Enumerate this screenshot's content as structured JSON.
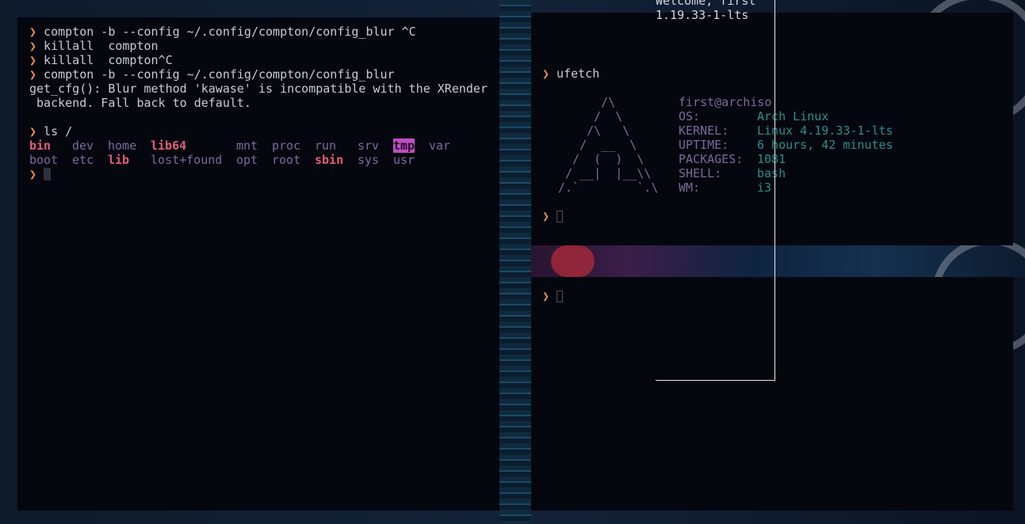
{
  "colors": {
    "prompt": "#f08a4b",
    "dir": "#7b6a9a",
    "bold_dir": "#e35e7a",
    "tmp_bg": "#c44cc4",
    "value": "#2a8f8a",
    "terminal_bg": "#05070f"
  },
  "terminal1": {
    "history": [
      {
        "prompt": "❯",
        "cmd": " compton -b --config ~/.config/compton/config_blur ^C"
      },
      {
        "prompt": "❯",
        "cmd": " killall  compton"
      },
      {
        "prompt": "❯",
        "cmd": " killall  compton^C"
      },
      {
        "prompt": "❯",
        "cmd": " compton -b --config ~/.config/compton/config_blur"
      }
    ],
    "error_line1": "get_cfg(): Blur method 'kawase' is incompatible with the XRender",
    "error_line2": " backend. Fall back to default.",
    "ls_prompt": "❯",
    "ls_cmd": " ls /",
    "ls_items": [
      {
        "name": "bin",
        "style": "b"
      },
      {
        "name": "dev",
        "style": "d"
      },
      {
        "name": "home",
        "style": "d"
      },
      {
        "name": "lib64",
        "style": "b"
      },
      {
        "name": "mnt",
        "style": "d"
      },
      {
        "name": "proc",
        "style": "d"
      },
      {
        "name": "run",
        "style": "d"
      },
      {
        "name": "srv",
        "style": "d"
      },
      {
        "name": "tmp",
        "style": "tmp"
      },
      {
        "name": "var",
        "style": "d"
      },
      {
        "name": "boot",
        "style": "d"
      },
      {
        "name": "etc",
        "style": "d"
      },
      {
        "name": "lib",
        "style": "b"
      },
      {
        "name": "lost+found",
        "style": "d"
      },
      {
        "name": "opt",
        "style": "d"
      },
      {
        "name": "root",
        "style": "d"
      },
      {
        "name": "sbin",
        "style": "b"
      },
      {
        "name": "sys",
        "style": "d"
      },
      {
        "name": "usr",
        "style": "d"
      },
      {
        "name": "",
        "style": "d"
      }
    ],
    "final_prompt": "❯"
  },
  "terminal2": {
    "prompt": "❯",
    "cmd": " ufetch",
    "logo": "      /\\\n     /  \\\n    /\\   \\\n   /  __  \\\n  /  (  )  \\\n / __|  |__\\\\\n/.`        `.\\",
    "user": "first@archiso",
    "info": [
      {
        "key": "OS:",
        "value": "Arch Linux"
      },
      {
        "key": "KERNEL:",
        "value": "Linux 4.19.33-1-lts"
      },
      {
        "key": "UPTIME:",
        "value": "6 hours, 42 minutes"
      },
      {
        "key": "PACKAGES:",
        "value": "1081"
      },
      {
        "key": "SHELL:",
        "value": "bash"
      },
      {
        "key": "WM:",
        "value": "i3"
      }
    ],
    "final_prompt": "❯"
  },
  "terminal3": {
    "prompt": "❯"
  },
  "overlay": {
    "line1": "Welcome, first",
    "line2": "1.19.33-1-lts"
  }
}
